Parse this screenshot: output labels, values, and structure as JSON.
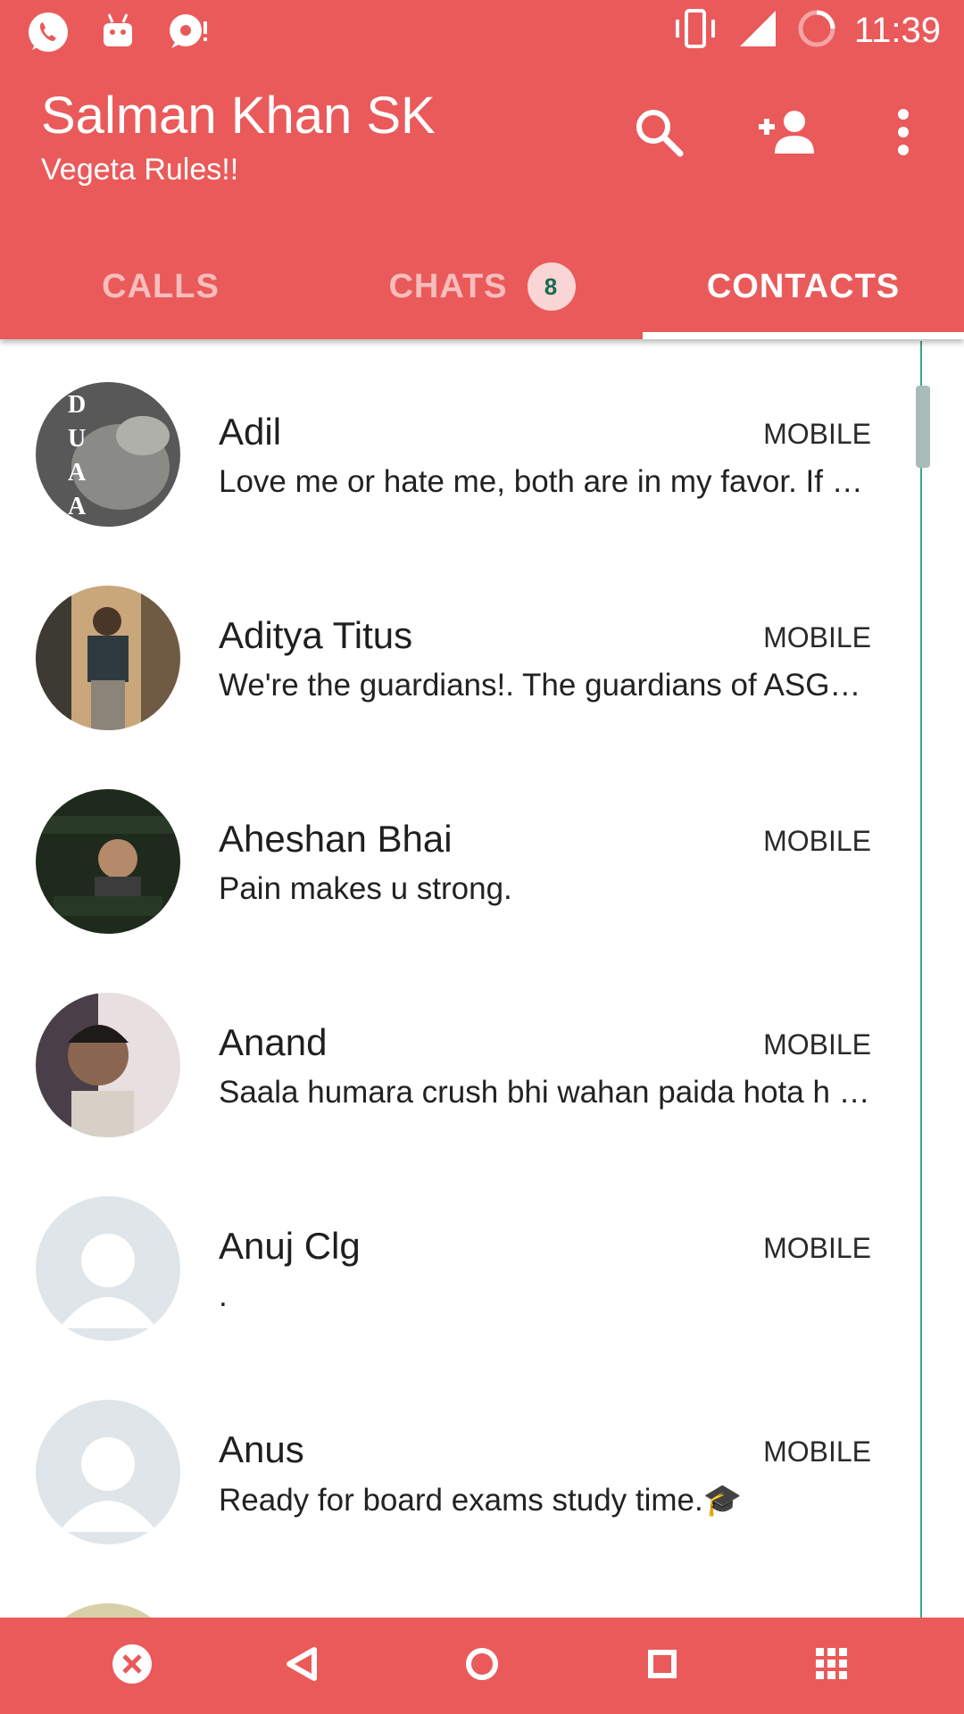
{
  "status_bar": {
    "time": "11:39",
    "left_icons": [
      "whatsapp-icon",
      "android-icon",
      "chat-bubble-icon"
    ],
    "right_icons": [
      "vibrate-icon",
      "signal-icon",
      "battery-icon"
    ]
  },
  "header": {
    "title": "Salman Khan SK",
    "subtitle": "Vegeta Rules!!",
    "actions": [
      "search-icon",
      "add-contact-icon",
      "more-vert-icon"
    ]
  },
  "tabs": [
    {
      "label": "CALLS"
    },
    {
      "label": "CHATS",
      "badge": "8"
    },
    {
      "label": "CONTACTS",
      "active": true
    }
  ],
  "contacts": [
    {
      "name": "Adil",
      "type": "MOBILE",
      "status": "Love me or hate me, both are in my favor. If you love me I will always be in your heart",
      "avatar": "photo"
    },
    {
      "name": "Aditya Titus",
      "type": "MOBILE",
      "status": "We're the guardians!. The guardians of ASGAARD",
      "avatar": "photo"
    },
    {
      "name": "Aheshan Bhai",
      "type": "MOBILE",
      "status": "Pain makes u strong.",
      "avatar": "photo"
    },
    {
      "name": "Anand",
      "type": "MOBILE",
      "status": "Saala humara crush bhi wahan paida hota h Jahan",
      "avatar": "photo"
    },
    {
      "name": "Anuj Clg",
      "type": "MOBILE",
      "status": ".",
      "avatar": "default"
    },
    {
      "name": "Anus",
      "type": "MOBILE",
      "status": "Ready for board exams study time.🎓",
      "avatar": "default"
    }
  ],
  "nav_bar": {
    "buttons": [
      "close-circle-icon",
      "back-icon",
      "home-icon",
      "recents-icon",
      "apps-grid-icon"
    ]
  },
  "colors": {
    "primary": "#ea5a5a",
    "badge_text": "#1a6b4f",
    "scroll_track": "#3aa58a"
  }
}
